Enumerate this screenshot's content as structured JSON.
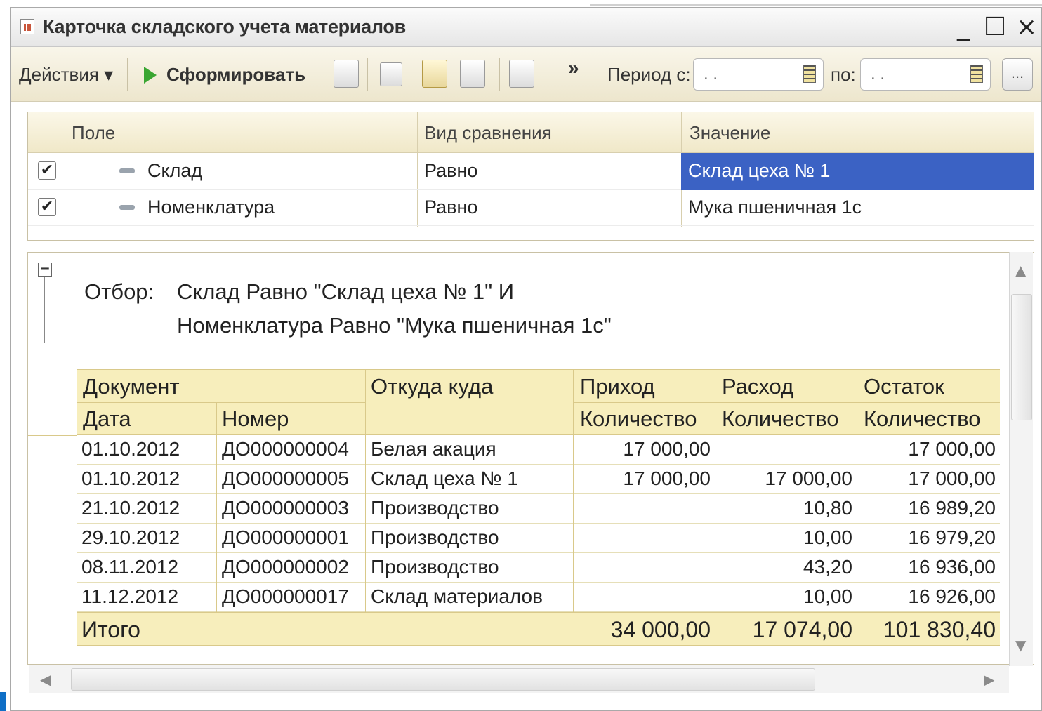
{
  "window": {
    "title": "Карточка складского учета материалов",
    "minimize": "_",
    "maximize": "☐",
    "close": "×"
  },
  "toolbar": {
    "actions_label": "Действия ▾",
    "generate_label": "Сформировать",
    "more_label": "»",
    "period_from_label": "Период с:",
    "period_from_value": ". .",
    "period_to_label": "по:",
    "period_to_value": ". .",
    "dots_label": "..."
  },
  "filter": {
    "headers": [
      "Поле",
      "Вид сравнения",
      "Значение"
    ],
    "rows": [
      {
        "checked": "✔",
        "field": "Склад",
        "comparison": "Равно",
        "value": "Склад цеха № 1"
      },
      {
        "checked": "✔",
        "field": "Номенклатура",
        "comparison": "Равно",
        "value": "Мука пшеничная 1с"
      }
    ]
  },
  "report": {
    "collapse": "−",
    "filter_label": "Отбор:",
    "filter_line1": "Склад Равно \"Склад цеха № 1\" И",
    "filter_line2": "Номенклатура Равно \"Мука пшеничная 1с\"",
    "headers": {
      "document": "Документ",
      "date": "Дата",
      "number": "Номер",
      "from_to": "Откуда куда",
      "income": "Приход",
      "income_sub": "Количество",
      "expense": "Расход",
      "expense_sub": "Количество",
      "balance": "Остаток",
      "balance_sub": "Количество"
    },
    "rows": [
      {
        "date": "01.10.2012",
        "number": "ДО000000004",
        "from_to": "Белая акация",
        "income": "17 000,00",
        "expense": "",
        "balance": "17 000,00"
      },
      {
        "date": "01.10.2012",
        "number": "ДО000000005",
        "from_to": "Склад цеха № 1",
        "income": "17 000,00",
        "expense": "17 000,00",
        "balance": "17 000,00"
      },
      {
        "date": "21.10.2012",
        "number": "ДО000000003",
        "from_to": "Производство",
        "income": "",
        "expense": "10,80",
        "balance": "16 989,20"
      },
      {
        "date": "29.10.2012",
        "number": "ДО000000001",
        "from_to": "Производство",
        "income": "",
        "expense": "10,00",
        "balance": "16 979,20"
      },
      {
        "date": "08.11.2012",
        "number": "ДО000000002",
        "from_to": "Производство",
        "income": "",
        "expense": "43,20",
        "balance": "16 936,00"
      },
      {
        "date": "11.12.2012",
        "number": "ДО000000017",
        "from_to": "Склад материалов",
        "income": "",
        "expense": "10,00",
        "balance": "16 926,00"
      }
    ],
    "total": {
      "label": "Итого",
      "income": "34 000,00",
      "expense": "17 074,00",
      "balance": "101 830,40"
    }
  },
  "scroll": {
    "up": "▲",
    "down": "▼",
    "left": "◀",
    "right": "▶"
  },
  "colors": {
    "selection": "#3b62c4",
    "header_fill": "#f7eebc",
    "toolbar_fill": "#ede6cd",
    "play_green": "#3aa632"
  }
}
